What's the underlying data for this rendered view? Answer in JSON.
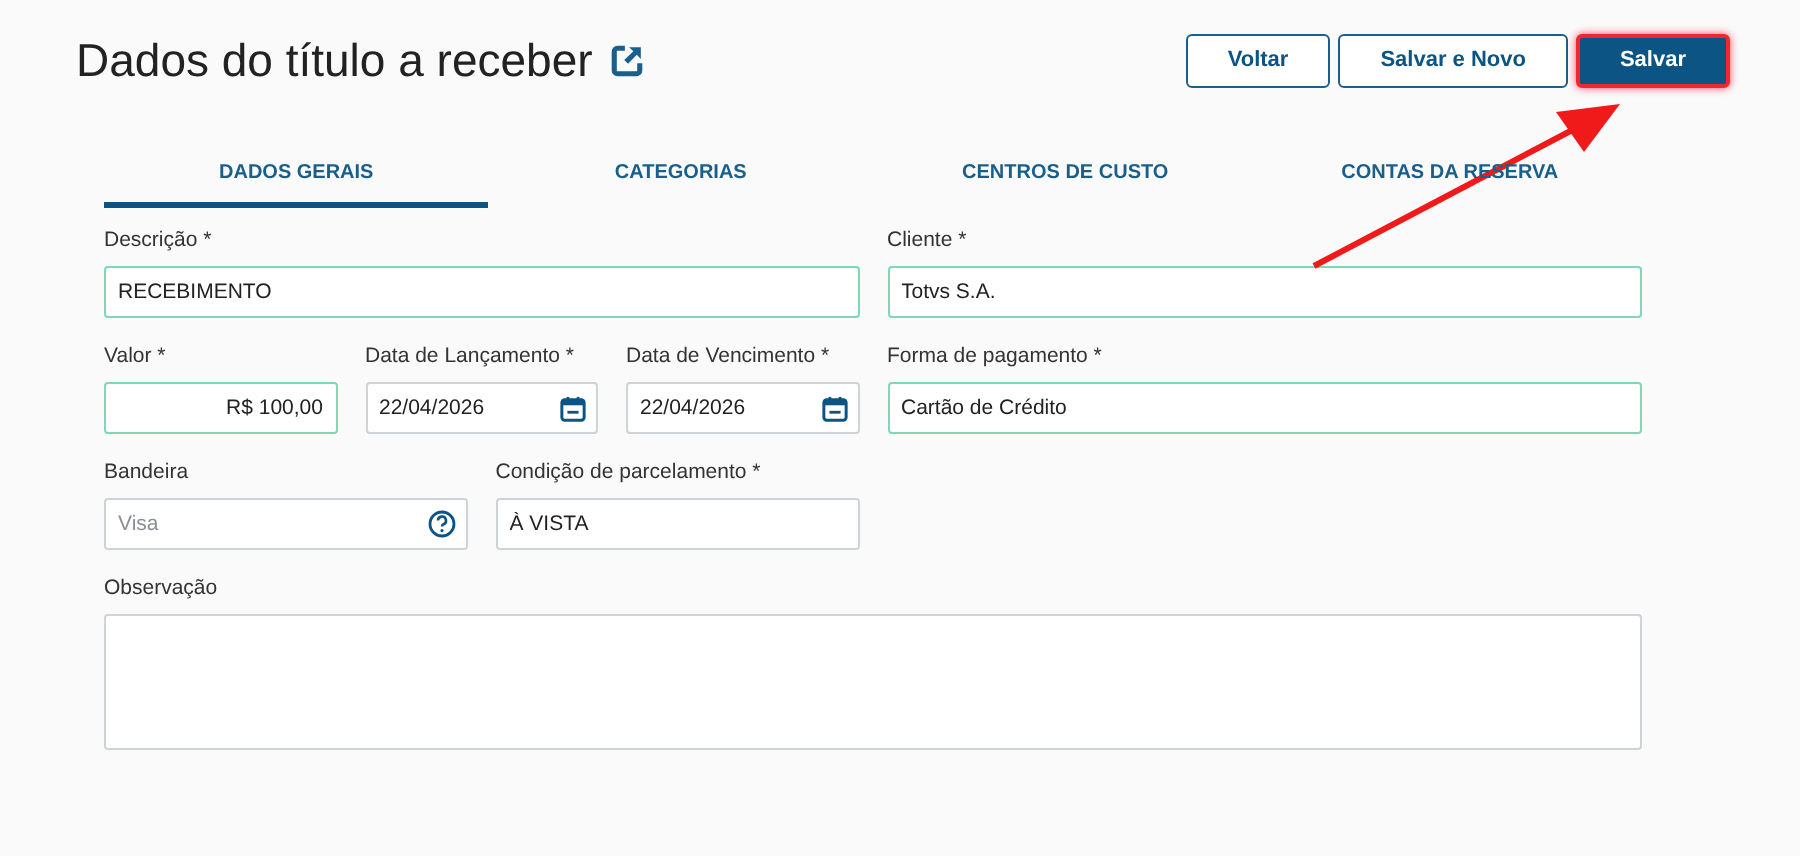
{
  "header": {
    "title": "Dados do título a receber",
    "buttons": [
      {
        "label": "Voltar",
        "kind": "secondary",
        "highlighted": false
      },
      {
        "label": "Salvar e Novo",
        "kind": "secondary",
        "highlighted": false
      },
      {
        "label": "Salvar",
        "kind": "primary",
        "highlighted": true
      }
    ]
  },
  "tabs": [
    {
      "label": "DADOS GERAIS",
      "selected": true
    },
    {
      "label": "CATEGORIAS",
      "selected": false
    },
    {
      "label": "CENTROS DE CUSTO",
      "selected": false
    },
    {
      "label": "CONTAS DA RESERVA",
      "selected": false
    }
  ],
  "form": {
    "rows": [
      {
        "fields": [
          {
            "label": "Descrição *",
            "kind": "text",
            "value": "RECEBIMENTO",
            "valid": true
          },
          {
            "label": "Cliente *",
            "kind": "text",
            "value": "Totvs S.A.",
            "valid": true
          }
        ]
      },
      {
        "fields": [
          {
            "label": "Valor *",
            "kind": "currency",
            "value": "R$ 100,00",
            "valid": true
          },
          {
            "label": "Data de Lançamento *",
            "kind": "date",
            "value": "22/04/2026",
            "valid": false
          },
          {
            "label": "Data de Vencimento *",
            "kind": "date",
            "value": "22/04/2026",
            "valid": false
          },
          {
            "label": "Forma de pagamento *",
            "kind": "text",
            "value": "Cartão de Crédito",
            "valid": true
          }
        ]
      },
      {
        "fields": [
          {
            "label": "Bandeira",
            "kind": "help",
            "placeholder": "Visa",
            "valid": false
          },
          {
            "label": "Condição de parcelamento *",
            "kind": "text",
            "value": "À VISTA",
            "valid": false
          }
        ]
      },
      {
        "fields": [
          {
            "label": "Observação",
            "kind": "textarea",
            "valid": false
          }
        ]
      }
    ]
  },
  "annotation": {
    "kind": "arrow"
  }
}
